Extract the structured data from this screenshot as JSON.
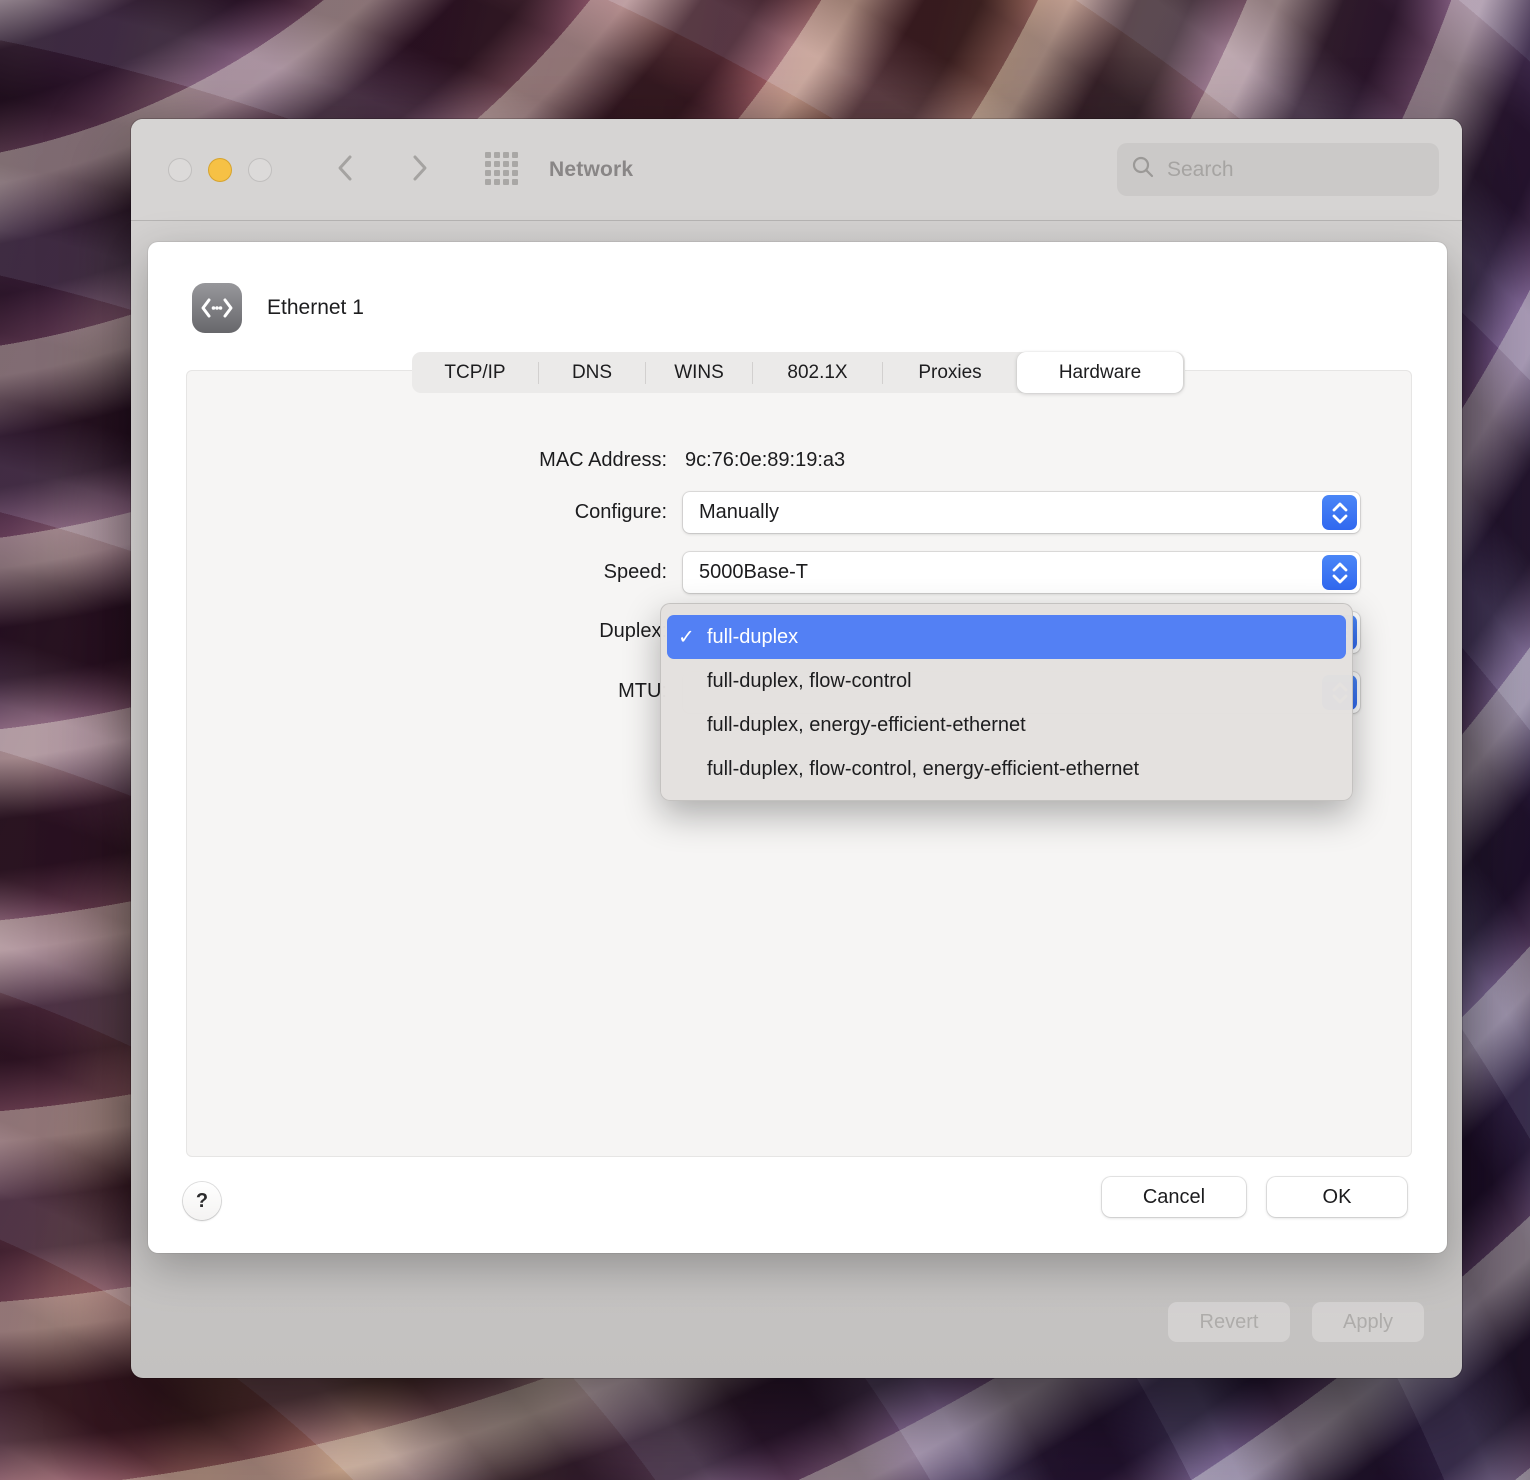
{
  "window": {
    "title": "Network",
    "search": {
      "placeholder": "Search"
    },
    "revert_label": "Revert",
    "apply_label": "Apply"
  },
  "sheet": {
    "service_name": "Ethernet 1",
    "tabs": [
      {
        "label": "TCP/IP"
      },
      {
        "label": "DNS"
      },
      {
        "label": "WINS"
      },
      {
        "label": "802.1X"
      },
      {
        "label": "Proxies"
      },
      {
        "label": "Hardware",
        "selected": true
      }
    ],
    "fields": {
      "mac_label": "MAC Address:",
      "mac_value": "9c:76:0e:89:19:a3",
      "configure_label": "Configure:",
      "configure_value": "Manually",
      "speed_label": "Speed:",
      "speed_value": "5000Base-T",
      "duplex_label": "Duplex:",
      "mtu_label": "MTU:"
    },
    "duplex_menu": {
      "selected_index": 0,
      "items": [
        {
          "label": "full-duplex"
        },
        {
          "label": "full-duplex, flow-control"
        },
        {
          "label": "full-duplex, energy-efficient-ethernet"
        },
        {
          "label": "full-duplex, flow-control, energy-efficient-ethernet"
        }
      ]
    },
    "help_label": "?",
    "cancel_label": "Cancel",
    "ok_label": "OK"
  },
  "icons": {
    "check": "✓"
  },
  "colors": {
    "accent_blue": "#3b74f2",
    "menu_highlight": "#5380f4",
    "minimize_yellow": "#f6c145"
  }
}
